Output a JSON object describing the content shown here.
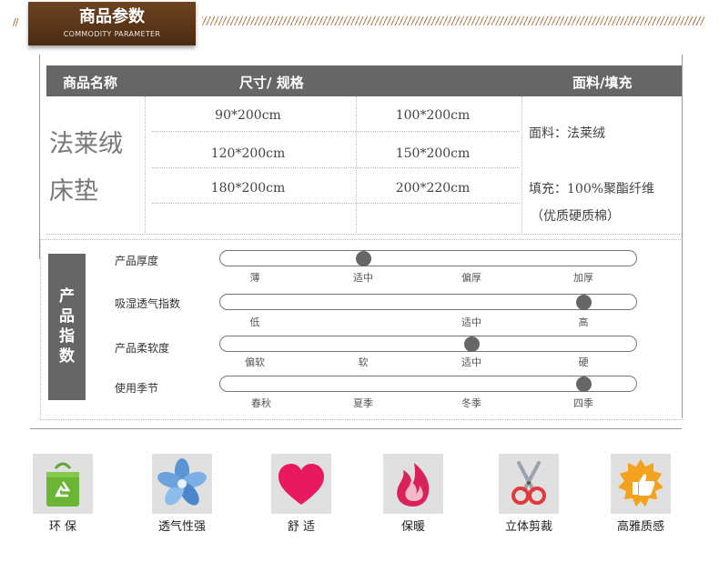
{
  "header": {
    "title": "商品参数",
    "subtitle": "COMMODITY PARAMETER"
  },
  "table": {
    "headers": {
      "name": "商品名称",
      "size": "尺寸/ 规格",
      "fabric": "面料/填充"
    },
    "product_name_lines": [
      "法莱绒",
      "床垫"
    ],
    "sizes": [
      [
        "90*200cm",
        "100*200cm"
      ],
      [
        "120*200cm",
        "150*200cm"
      ],
      [
        "180*200cm",
        "200*220cm"
      ]
    ],
    "fabric_lines": [
      "面料：法莱绒",
      "填充：100%聚酯纤维",
      "（优质硬质棉）"
    ]
  },
  "index": {
    "tab_chars": [
      "产",
      "品",
      "指",
      "数"
    ],
    "rows": [
      {
        "label": "产品厚度",
        "ticks": [
          "薄",
          "适中",
          "偏厚",
          "加厚"
        ],
        "level_index": 1
      },
      {
        "label": "吸湿透气指数",
        "ticks": [
          "低",
          "适中",
          "高"
        ],
        "level_index": 2
      },
      {
        "label": "产品柔软度",
        "ticks": [
          "偏软",
          "软",
          "适中",
          "硬"
        ],
        "level_index": 2
      },
      {
        "label": "使用季节",
        "ticks": [
          "春秋",
          "夏季",
          "冬季",
          "四季"
        ],
        "level_index": 3
      }
    ],
    "knob_color": "#666666"
  },
  "features": [
    {
      "label": "环 保",
      "icon": "eco-bag-icon"
    },
    {
      "label": "透气性强",
      "icon": "fan-icon"
    },
    {
      "label": "舒 适",
      "icon": "heart-icon"
    },
    {
      "label": "保暖",
      "icon": "flame-icon"
    },
    {
      "label": "立体剪裁",
      "icon": "scissors-icon"
    },
    {
      "label": "高雅质感",
      "icon": "thumbs-up-icon"
    }
  ]
}
